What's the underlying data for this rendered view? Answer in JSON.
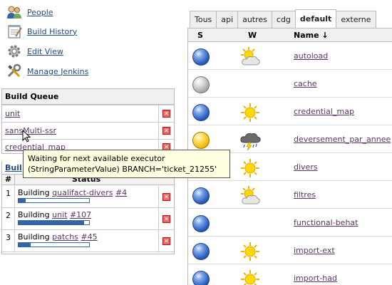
{
  "nav": {
    "items": [
      {
        "label": "People",
        "icon": "people-icon"
      },
      {
        "label": "Build History",
        "icon": "notepad-icon"
      },
      {
        "label": "Edit View",
        "icon": "gear-icon"
      },
      {
        "label": "Manage Jenkins",
        "icon": "tools-icon"
      }
    ]
  },
  "build_queue": {
    "title": "Build Queue",
    "items": [
      "unit",
      "sansMulti-ssr",
      "credential_map"
    ]
  },
  "executors": {
    "title_partial": "Buil",
    "col_num": "#",
    "col_status": "Status",
    "rows": [
      {
        "num": "1",
        "prefix": "Building ",
        "job": "qualifact-divers",
        "build": "#4",
        "progress": 0.1
      },
      {
        "num": "2",
        "prefix": "Building ",
        "job": "unit",
        "build": "#107",
        "progress": 0.93
      },
      {
        "num": "3",
        "prefix": "Building ",
        "job": "patchs",
        "build": "#45",
        "progress": 0.17
      }
    ]
  },
  "tooltip": {
    "line1": "Waiting for next available executor",
    "line2": "(StringParameterValue) BRANCH='ticket_21255'"
  },
  "tabs": [
    {
      "label": "Tous",
      "active": false
    },
    {
      "label": "api",
      "active": false
    },
    {
      "label": "autres",
      "active": false
    },
    {
      "label": "cdg",
      "active": false
    },
    {
      "label": "default",
      "active": true
    },
    {
      "label": "externe",
      "active": false
    }
  ],
  "jobs_table": {
    "col_s": "S",
    "col_w": "W",
    "col_name": "Name ↓",
    "rows": [
      {
        "status": "blue",
        "weather": "partly-cloudy",
        "name": "autoload"
      },
      {
        "status": "grey",
        "weather": "none",
        "name": "cache"
      },
      {
        "status": "blue",
        "weather": "sunny",
        "name": "credential_map"
      },
      {
        "status": "yellow",
        "weather": "storm",
        "name": "deversement_par_annee"
      },
      {
        "status": "blue",
        "weather": "sunny",
        "name": "divers"
      },
      {
        "status": "blue",
        "weather": "partly-cloudy",
        "name": "filtres"
      },
      {
        "status": "blue",
        "weather": "none",
        "name": "functional-behat"
      },
      {
        "status": "blue",
        "weather": "sunny",
        "name": "import-ext"
      },
      {
        "status": "blue",
        "weather": "sunny",
        "name": "import-had"
      }
    ]
  },
  "colors": {
    "link": "#5c3566",
    "nav_link": "#204a87",
    "progress": "#3465a4",
    "tooltip_bg": "#ffffe1"
  }
}
